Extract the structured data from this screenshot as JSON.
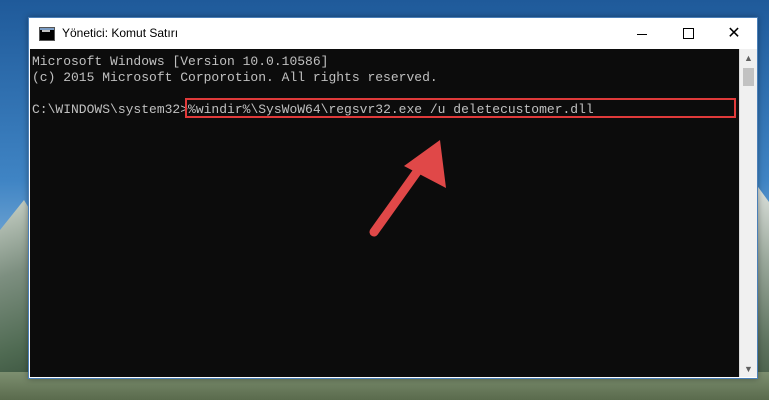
{
  "window": {
    "title": "Yönetici: Komut Satırı",
    "minimize_glyph": "",
    "maximize_glyph": "",
    "close_glyph": "✕"
  },
  "console": {
    "line1": "Microsoft Windows [Version 10.0.10586]",
    "line2": "(c) 2015 Microsoft Corporotion. All rights reserved.",
    "prompt": "C:\\WINDOWS\\system32>",
    "command": "%windir%\\SysWoW64\\regsvr32.exe /u deletecustomer.dll"
  },
  "scrollbar": {
    "up_glyph": "▲",
    "down_glyph": "▼"
  },
  "colors": {
    "highlight": "#e03a3a",
    "console_bg": "#0c0c0c",
    "console_text": "#c0c0c0"
  }
}
